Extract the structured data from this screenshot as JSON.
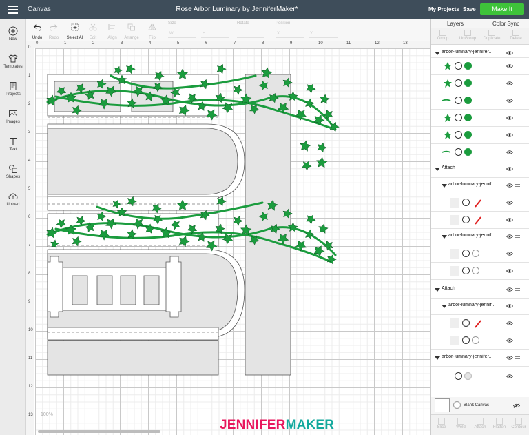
{
  "topbar": {
    "app_name": "Canvas",
    "title": "Rose Arbor Luminary by JenniferMaker*",
    "my_projects": "My Projects",
    "save": "Save",
    "make_it": "Make It",
    "accent": "#3ec33a"
  },
  "sidebar": {
    "items": [
      {
        "label": "New",
        "icon": "plus-circle-icon"
      },
      {
        "label": "Templates",
        "icon": "shirt-icon"
      },
      {
        "label": "Projects",
        "icon": "projects-icon"
      },
      {
        "label": "Images",
        "icon": "images-icon"
      },
      {
        "label": "Text",
        "icon": "text-icon"
      },
      {
        "label": "Shapes",
        "icon": "shapes-icon"
      },
      {
        "label": "Upload",
        "icon": "upload-cloud-icon"
      }
    ]
  },
  "toolbar": {
    "undo": "Undo",
    "redo": "Redo",
    "select_all": "Select All",
    "edit": "Edit",
    "align": "Align",
    "arrange": "Arrange",
    "flip": "Flip",
    "size": "Size",
    "w": "W",
    "h": "H",
    "rotate": "Rotate",
    "position": "Position",
    "x": "X",
    "y": "Y"
  },
  "rulers": {
    "top": [
      "0",
      "1",
      "2",
      "3",
      "4",
      "5",
      "6",
      "7",
      "8",
      "9",
      "10",
      "11",
      "12",
      "13"
    ],
    "left": [
      "0",
      "1",
      "2",
      "3",
      "4",
      "5",
      "6",
      "7",
      "8",
      "9",
      "10",
      "11",
      "12",
      "13"
    ]
  },
  "canvas": {
    "zoom": "100%",
    "watermark_part1": "JENNIFER",
    "watermark_part2": "MAKER",
    "watermark_color1": "#e8175d",
    "watermark_color2": "#14a99d",
    "leaf_color": "#1b9c3e",
    "panel_fill": "#e4e4e4"
  },
  "panel": {
    "tab_layers": "Layers",
    "tab_color_sync": "Color Sync",
    "actions": [
      "Group",
      "UnGroup",
      "Duplicate",
      "Delete"
    ],
    "groups": [
      {
        "title": "arbor-lumnary-jennifer...",
        "rows": 6
      },
      {
        "title": "Attach"
      },
      {
        "title": "arbor-lumnary-jennif..."
      },
      {
        "title": "arbor-lumnary-jennif..."
      },
      {
        "title": "Attach"
      },
      {
        "title": "arbor-lumnary-jennif..."
      },
      {
        "title": "arbor-lumnary-jennifer..."
      }
    ],
    "blank_canvas": "Blank Canvas",
    "bottom": [
      "Slice",
      "Weld",
      "Attach",
      "Flatten",
      "Contour"
    ]
  }
}
